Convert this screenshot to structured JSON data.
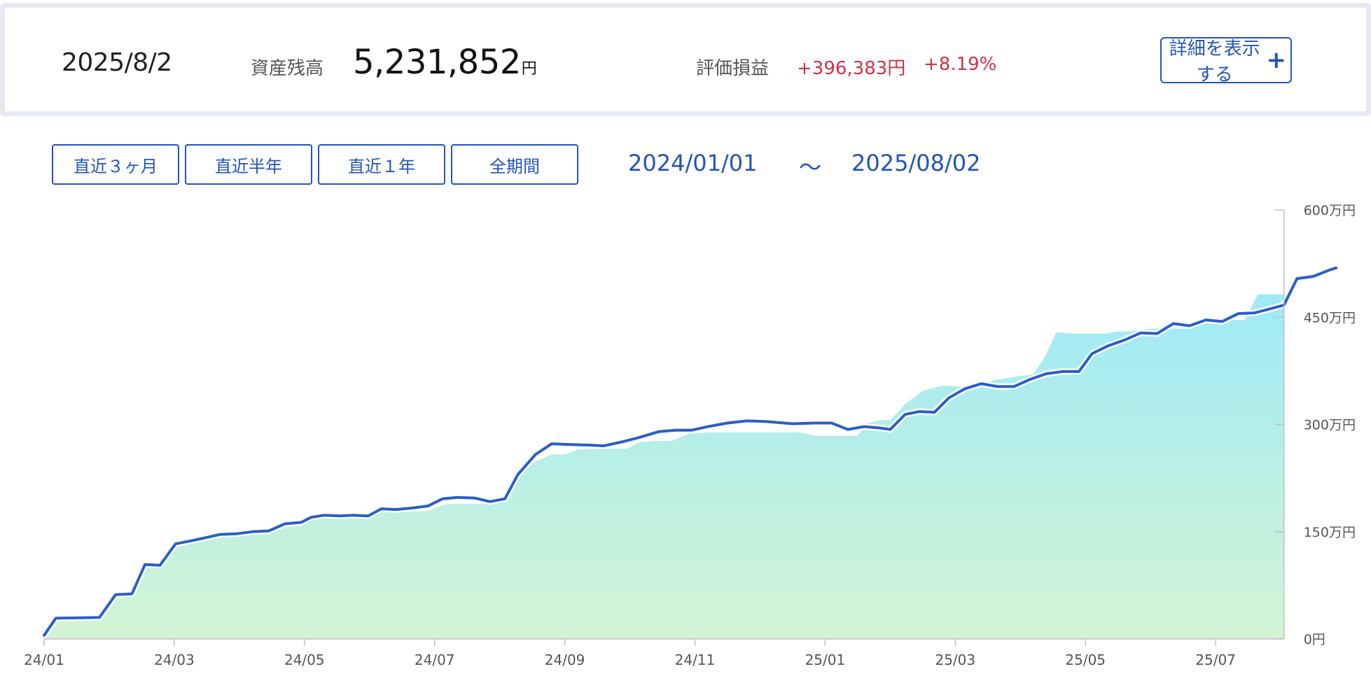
{
  "summary": {
    "date": "2025/8/2",
    "asset_label": "資産残高",
    "asset_value": "5,231,852",
    "asset_unit": "円",
    "pl_label": "評価損益",
    "pl_value": "+396,383円",
    "pl_percent": "+8.19%",
    "detail_button": "詳細を表示する"
  },
  "periods": [
    "直近３ヶ月",
    "直近半年",
    "直近１年",
    "全期間"
  ],
  "range": {
    "start": "2024/01/01",
    "separator": "～",
    "end": "2025/08/02"
  },
  "colors": {
    "accent": "#2454b8",
    "gain": "#d0304a",
    "area_top": "#9feaf7",
    "area_bottom": "#d3f4d4",
    "line": "#2a5fc8"
  },
  "chart_data": {
    "type": "area",
    "ylim": [
      0,
      600
    ],
    "yticks": [
      0,
      150,
      300,
      450,
      600
    ],
    "ytick_labels": [
      "0円",
      "150万円",
      "300万円",
      "450万円",
      "600万円"
    ],
    "xticks": [
      0,
      2,
      4,
      6,
      8,
      10,
      12,
      14,
      16,
      18
    ],
    "xtick_labels": [
      "24/01",
      "24/03",
      "24/05",
      "24/07",
      "24/09",
      "24/11",
      "25/01",
      "25/03",
      "25/05",
      "25/07"
    ],
    "xlim": [
      0,
      19.05
    ],
    "series": [
      {
        "name": "",
        "kind": "area",
        "points": [
          [
            0,
            5
          ],
          [
            0.2,
            27
          ],
          [
            0.85,
            28
          ],
          [
            1.1,
            60
          ],
          [
            1.35,
            60
          ],
          [
            1.55,
            103
          ],
          [
            1.75,
            103
          ],
          [
            2.0,
            133
          ],
          [
            2.2,
            136
          ],
          [
            2.5,
            141
          ],
          [
            2.75,
            144
          ],
          [
            3.0,
            145
          ],
          [
            3.25,
            147
          ],
          [
            3.5,
            148
          ],
          [
            3.7,
            158
          ],
          [
            3.9,
            160
          ],
          [
            4.1,
            167
          ],
          [
            4.35,
            169
          ],
          [
            4.7,
            169
          ],
          [
            5.0,
            169
          ],
          [
            5.2,
            178
          ],
          [
            5.45,
            178
          ],
          [
            5.9,
            179
          ],
          [
            6.15,
            188
          ],
          [
            6.4,
            189
          ],
          [
            6.8,
            189
          ],
          [
            7.0,
            193
          ],
          [
            7.3,
            233
          ],
          [
            7.55,
            248
          ],
          [
            7.8,
            258
          ],
          [
            8.0,
            258
          ],
          [
            8.2,
            265
          ],
          [
            8.5,
            266
          ],
          [
            8.95,
            266
          ],
          [
            9.15,
            275
          ],
          [
            9.4,
            277
          ],
          [
            9.65,
            277
          ],
          [
            9.9,
            287
          ],
          [
            10.25,
            289
          ],
          [
            10.55,
            289
          ],
          [
            10.9,
            289
          ],
          [
            11.3,
            289
          ],
          [
            11.6,
            289
          ],
          [
            11.85,
            284
          ],
          [
            12.2,
            284
          ],
          [
            12.5,
            284
          ],
          [
            12.65,
            302
          ],
          [
            12.85,
            306
          ],
          [
            13.0,
            306
          ],
          [
            13.25,
            330
          ],
          [
            13.5,
            347
          ],
          [
            13.8,
            354
          ],
          [
            14.05,
            353
          ],
          [
            14.3,
            353
          ],
          [
            14.6,
            362
          ],
          [
            14.95,
            367
          ],
          [
            15.2,
            370
          ],
          [
            15.4,
            398
          ],
          [
            15.55,
            429
          ],
          [
            15.8,
            427
          ],
          [
            16.3,
            427
          ],
          [
            16.5,
            430
          ],
          [
            16.7,
            430
          ],
          [
            17.0,
            434
          ],
          [
            17.3,
            434
          ],
          [
            17.6,
            434
          ],
          [
            17.8,
            446
          ],
          [
            18.05,
            446
          ],
          [
            18.45,
            446
          ],
          [
            18.65,
            482
          ],
          [
            19.05,
            482
          ]
        ]
      },
      {
        "name": "",
        "kind": "line",
        "points": [
          [
            0,
            5
          ],
          [
            0.18,
            29
          ],
          [
            0.85,
            30
          ],
          [
            1.1,
            62
          ],
          [
            1.35,
            63
          ],
          [
            1.55,
            104
          ],
          [
            1.78,
            103
          ],
          [
            2.02,
            133
          ],
          [
            2.25,
            137
          ],
          [
            2.5,
            142
          ],
          [
            2.7,
            146
          ],
          [
            2.95,
            147
          ],
          [
            3.2,
            150
          ],
          [
            3.45,
            151
          ],
          [
            3.7,
            161
          ],
          [
            3.95,
            163
          ],
          [
            4.1,
            170
          ],
          [
            4.3,
            173
          ],
          [
            4.55,
            172
          ],
          [
            4.75,
            173
          ],
          [
            4.98,
            172
          ],
          [
            5.18,
            182
          ],
          [
            5.4,
            181
          ],
          [
            5.65,
            183
          ],
          [
            5.9,
            186
          ],
          [
            6.12,
            196
          ],
          [
            6.35,
            198
          ],
          [
            6.62,
            197
          ],
          [
            6.85,
            192
          ],
          [
            7.08,
            196
          ],
          [
            7.28,
            230
          ],
          [
            7.55,
            258
          ],
          [
            7.8,
            273
          ],
          [
            8.05,
            272
          ],
          [
            8.4,
            271
          ],
          [
            8.6,
            270
          ],
          [
            8.9,
            276
          ],
          [
            9.15,
            282
          ],
          [
            9.45,
            290
          ],
          [
            9.7,
            292
          ],
          [
            9.95,
            292
          ],
          [
            10.2,
            297
          ],
          [
            10.5,
            302
          ],
          [
            10.8,
            305
          ],
          [
            11.1,
            304
          ],
          [
            11.5,
            301
          ],
          [
            11.85,
            302
          ],
          [
            12.1,
            302
          ],
          [
            12.35,
            293
          ],
          [
            12.6,
            297
          ],
          [
            12.85,
            295
          ],
          [
            13.0,
            293
          ],
          [
            13.23,
            314
          ],
          [
            13.45,
            318
          ],
          [
            13.68,
            317
          ],
          [
            13.9,
            337
          ],
          [
            14.15,
            350
          ],
          [
            14.4,
            357
          ],
          [
            14.65,
            353
          ],
          [
            14.9,
            353
          ],
          [
            15.15,
            363
          ],
          [
            15.4,
            371
          ],
          [
            15.65,
            374
          ],
          [
            15.9,
            374
          ],
          [
            16.1,
            399
          ],
          [
            16.35,
            410
          ],
          [
            16.6,
            418
          ],
          [
            16.85,
            428
          ],
          [
            17.1,
            427
          ],
          [
            17.35,
            441
          ],
          [
            17.6,
            438
          ],
          [
            17.85,
            446
          ],
          [
            18.1,
            444
          ],
          [
            18.35,
            455
          ],
          [
            18.6,
            456
          ],
          [
            18.85,
            462
          ],
          [
            19.05,
            467
          ],
          [
            19.25,
            504
          ],
          [
            19.5,
            507
          ],
          [
            19.75,
            516
          ],
          [
            19.85,
            519
          ]
        ]
      }
    ]
  }
}
